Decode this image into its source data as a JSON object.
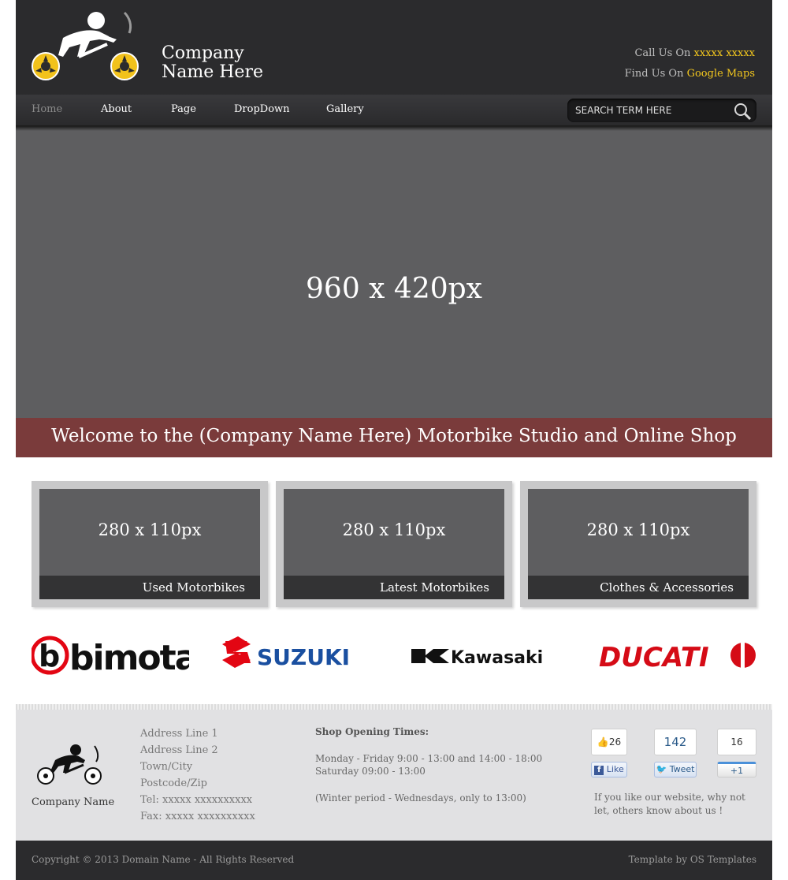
{
  "header": {
    "company_line1": "Company",
    "company_line2": "Name Here",
    "call_label": "Call Us On",
    "call_value": "xxxxx xxxxx",
    "find_label": "Find Us On",
    "find_value": "Google Maps",
    "logo_icon": "motorbike-rider-icon"
  },
  "nav": {
    "items": [
      {
        "label": "Home",
        "active": true
      },
      {
        "label": "About"
      },
      {
        "label": "Page"
      },
      {
        "label": "DropDown"
      },
      {
        "label": "Gallery"
      }
    ],
    "search_placeholder": "SEARCH TERM HERE",
    "search_icon": "search-icon"
  },
  "hero": {
    "placeholder": "960 x 420px",
    "welcome": "Welcome to the (Company Name Here) Motorbike Studio and Online Shop"
  },
  "features": [
    {
      "placeholder": "280 x 110px",
      "caption": "Used Motorbikes"
    },
    {
      "placeholder": "280 x 110px",
      "caption": "Latest Motorbikes"
    },
    {
      "placeholder": "280 x 110px",
      "caption": "Clothes & Accessories"
    }
  ],
  "brands": [
    {
      "name": "bimota",
      "color": "#e30613"
    },
    {
      "name": "SUZUKI",
      "color": "#1a4fa0"
    },
    {
      "name": "Kawasaki",
      "color": "#111111"
    },
    {
      "name": "DUCATI",
      "color": "#d50b16"
    }
  ],
  "footer": {
    "company_name": "Company Name",
    "address_lines": [
      "Address Line 1",
      "Address Line 2",
      "Town/City",
      "Postcode/Zip",
      "Tel: xxxxx xxxxxxxxxx",
      "Fax: xxxxx xxxxxxxxxx"
    ],
    "hours_title": "Shop Opening Times:",
    "hours_line1": "Monday - Friday 9:00 - 13:00 and 14:00 - 18:00",
    "hours_line2": "Saturday 09:00 - 13:00",
    "hours_note": "(Winter period - Wednesdays, only to 13:00)",
    "social": {
      "like_count": "26",
      "like_label": "Like",
      "tweet_count": "142",
      "tweet_label": "Tweet",
      "plus_count": "16",
      "plus_label": "+1"
    },
    "share_note": "If you like our website, why not let, others know about us !"
  },
  "bottom": {
    "copyright": "Copyright © 2013 Domain Name - All Rights Reserved",
    "credit": "Template by OS Templates"
  }
}
